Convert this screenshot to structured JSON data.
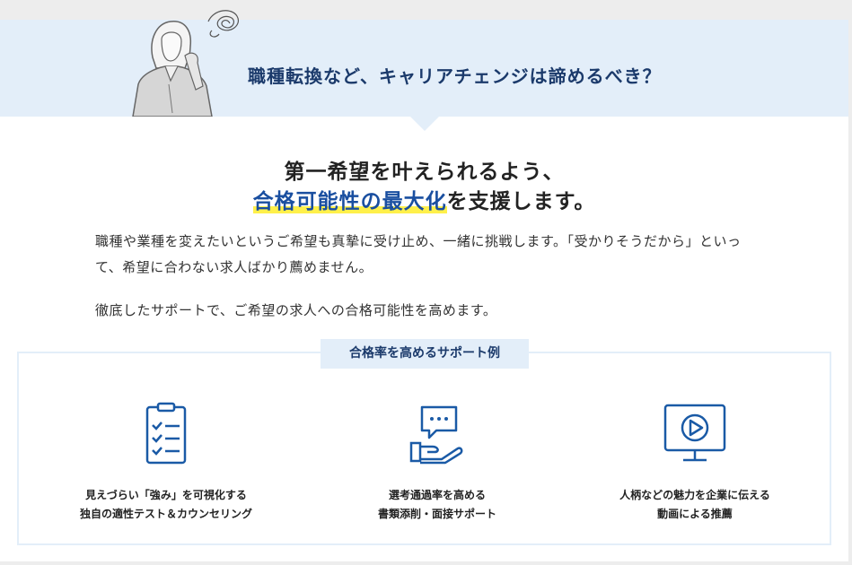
{
  "banner": {
    "title": "職種転換など、キャリアチェンジは諦めるべき？"
  },
  "headline": {
    "line1": "第一希望を叶えられるよう、",
    "accent": "合格可能性の最大化",
    "rest": "を支援します。"
  },
  "body": {
    "paragraph1": "職種や業種を変えたいというご希望も真摯に受け止め、一緒に挑戦します。「受かりそうだから」といって、希望に合わない求人ばかり薦めません。",
    "paragraph2": "徹底したサポートで、ご希望の求人への合格可能性を高めます。"
  },
  "support": {
    "label": "合格率を高めるサポート例",
    "items": [
      {
        "icon": "checklist-icon",
        "line1": "見えづらい「強み」を可視化する",
        "line2": "独自の適性テスト＆カウンセリング"
      },
      {
        "icon": "speech-hand-icon",
        "line1": "選考通過率を高める",
        "line2": "書類添削・面接サポート"
      },
      {
        "icon": "video-monitor-icon",
        "line1": "人柄などの魅力を企業に伝える",
        "line2": "動画による推薦"
      }
    ]
  },
  "colors": {
    "accent_blue": "#1a4fa0",
    "navy": "#1b3a6b",
    "banner_bg": "#e3eef9",
    "highlight": "#fff04a"
  }
}
